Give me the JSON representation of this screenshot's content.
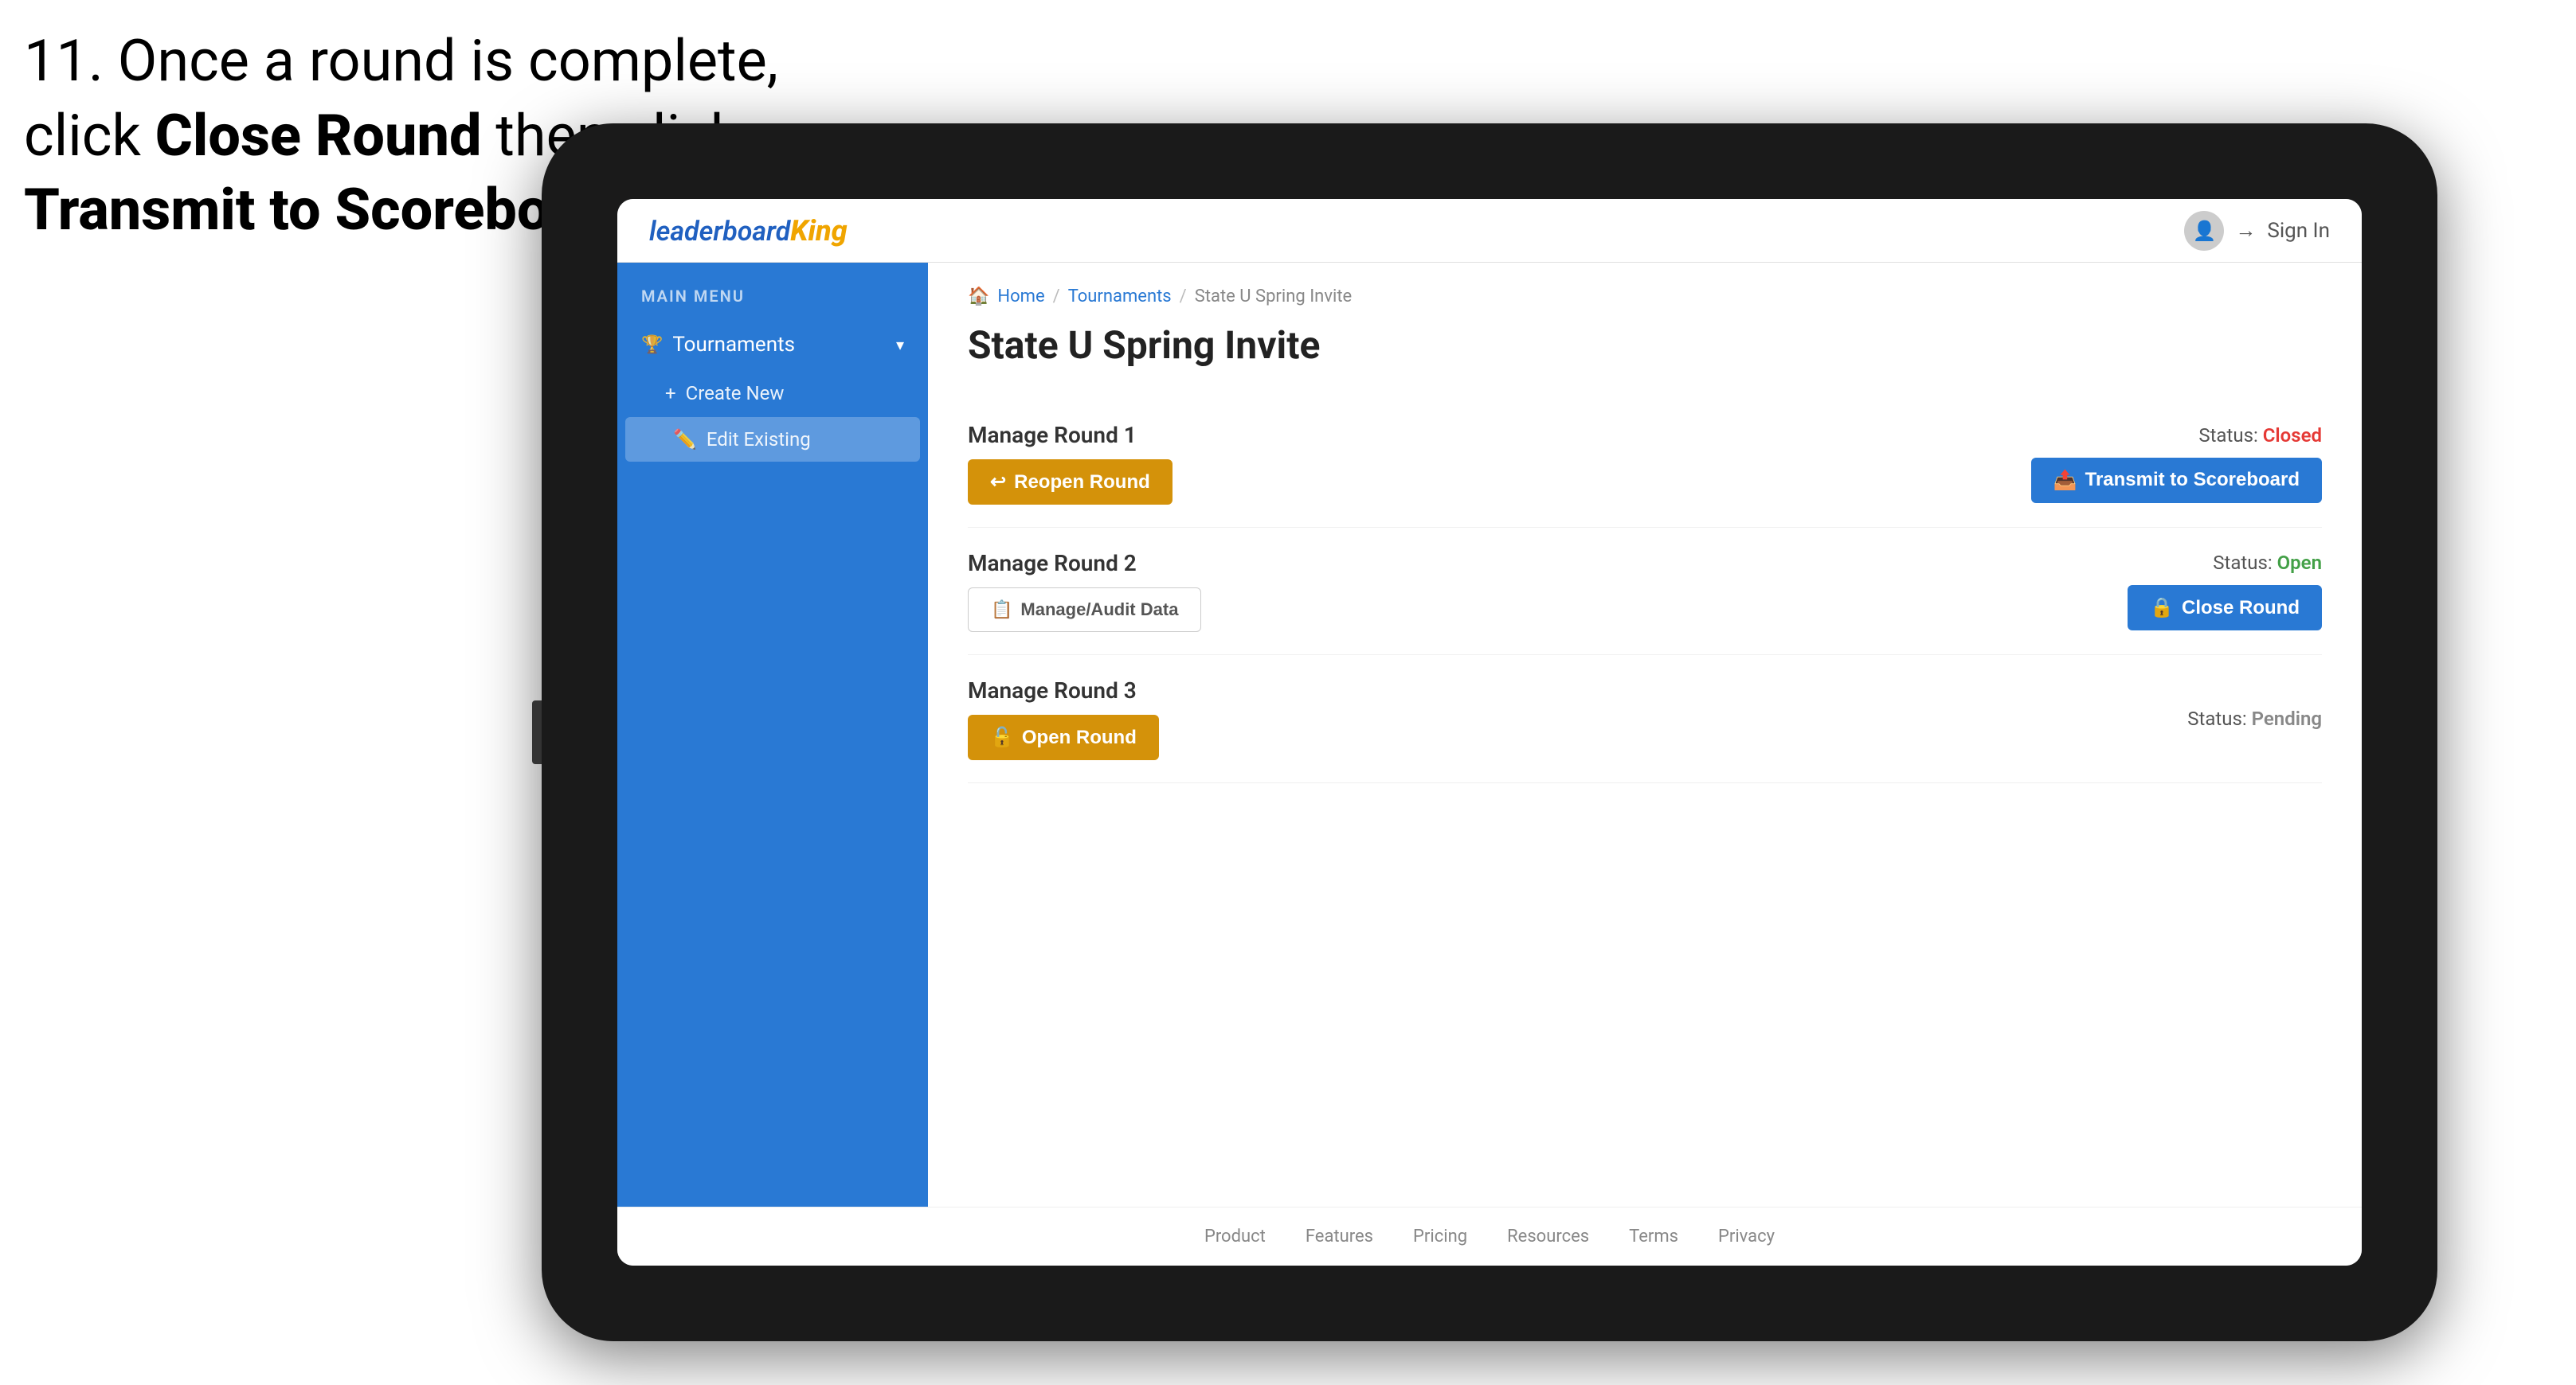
{
  "instruction": {
    "step_number": "11.",
    "line1": "Once a round is complete,",
    "line2_prefix": "click ",
    "line2_bold": "Close Round",
    "line2_suffix": " then click",
    "line3_bold": "Transmit to Scoreboard."
  },
  "top_nav": {
    "logo_leaderboard": "leaderboard",
    "logo_king": "King",
    "sign_in_label": "Sign In"
  },
  "sidebar": {
    "main_menu_label": "MAIN MENU",
    "items": [
      {
        "label": "Tournaments",
        "icon": "🏆",
        "expanded": true,
        "sub_items": [
          {
            "label": "Create New",
            "icon": "+"
          },
          {
            "label": "Edit Existing",
            "icon": "✏️",
            "selected": true
          }
        ]
      }
    ]
  },
  "breadcrumb": {
    "items": [
      "Home",
      "Tournaments",
      "State U Spring Invite"
    ]
  },
  "page": {
    "title": "State U Spring Invite",
    "rounds": [
      {
        "id": 1,
        "label": "Manage Round 1",
        "status_label": "Status:",
        "status_value": "Closed",
        "status_type": "closed",
        "left_button": {
          "label": "Reopen Round",
          "type": "gold",
          "icon": "↩"
        },
        "right_button": {
          "label": "Transmit to Scoreboard",
          "type": "blue",
          "icon": "📤"
        }
      },
      {
        "id": 2,
        "label": "Manage Round 2",
        "status_label": "Status:",
        "status_value": "Open",
        "status_type": "open",
        "left_button": {
          "label": "Manage/Audit Data",
          "type": "outline",
          "icon": "📋"
        },
        "right_button": {
          "label": "Close Round",
          "type": "blue",
          "icon": "🔒"
        }
      },
      {
        "id": 3,
        "label": "Manage Round 3",
        "status_label": "Status:",
        "status_value": "Pending",
        "status_type": "pending",
        "left_button": {
          "label": "Open Round",
          "type": "gold",
          "icon": "🔓"
        },
        "right_button": null
      }
    ]
  },
  "footer": {
    "links": [
      "Product",
      "Features",
      "Pricing",
      "Resources",
      "Terms",
      "Privacy"
    ]
  }
}
